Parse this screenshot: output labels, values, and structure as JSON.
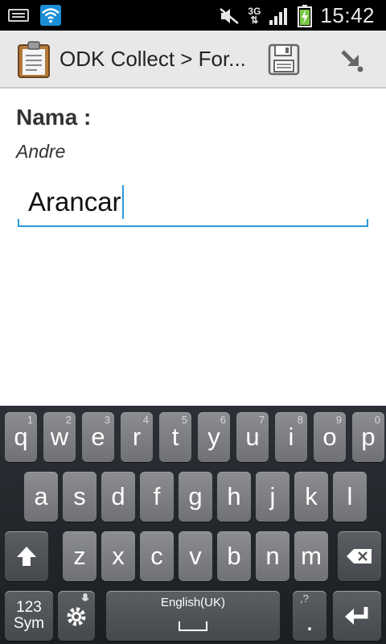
{
  "status_bar": {
    "time": "15:42",
    "network": "3G",
    "icons": [
      "keyboard-icon",
      "wifi-icon",
      "mute-icon",
      "signal-icon",
      "battery-charging-icon"
    ]
  },
  "action_bar": {
    "title": "ODK Collect > For...",
    "icons": [
      "clipboard-icon",
      "save-icon",
      "next-arrow-icon"
    ]
  },
  "question": {
    "label": "Nama :",
    "hint": "Andre",
    "value": "Arancar"
  },
  "keyboard": {
    "row1": [
      {
        "key": "q",
        "num": "1"
      },
      {
        "key": "w",
        "num": "2"
      },
      {
        "key": "e",
        "num": "3"
      },
      {
        "key": "r",
        "num": "4"
      },
      {
        "key": "t",
        "num": "5"
      },
      {
        "key": "y",
        "num": "6"
      },
      {
        "key": "u",
        "num": "7"
      },
      {
        "key": "i",
        "num": "8"
      },
      {
        "key": "o",
        "num": "9"
      },
      {
        "key": "p",
        "num": "0"
      }
    ],
    "row2": [
      "a",
      "s",
      "d",
      "f",
      "g",
      "h",
      "j",
      "k",
      "l"
    ],
    "row3": [
      "z",
      "x",
      "c",
      "v",
      "b",
      "n",
      "m"
    ],
    "sym_label_1": "123",
    "sym_label_2": "Sym",
    "space_label": "English(UK)",
    "period": ".",
    "period_hint": ",?",
    "accent_color": "#2a9ad6"
  }
}
